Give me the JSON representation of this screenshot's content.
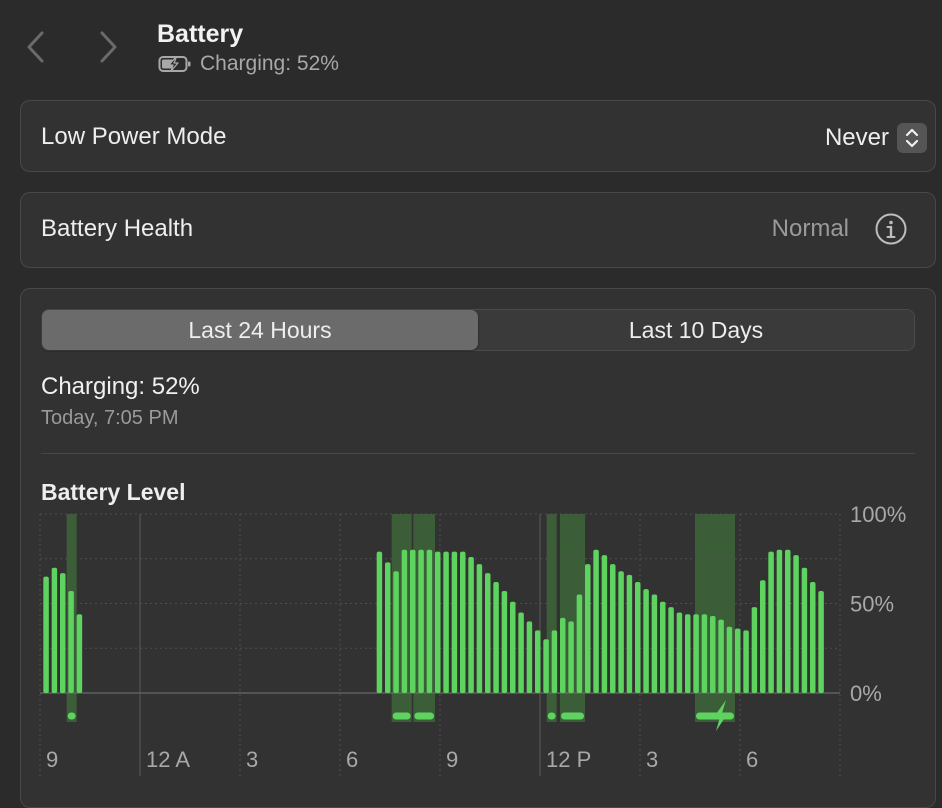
{
  "header": {
    "title": "Battery",
    "subtitle": "Charging: 52%",
    "back_icon": "chevron-left-icon",
    "forward_icon": "chevron-right-icon",
    "battery_icon": "battery-charging-icon"
  },
  "low_power_mode": {
    "label": "Low Power Mode",
    "value": "Never",
    "icon": "up-down-chevron-icon"
  },
  "battery_health": {
    "label": "Battery Health",
    "value": "Normal",
    "icon": "info-circle-icon"
  },
  "usage": {
    "tabs": [
      {
        "label": "Last 24 Hours",
        "selected": true
      },
      {
        "label": "Last 10 Days",
        "selected": false
      }
    ],
    "status": "Charging: 52%",
    "timestamp": "Today, 7:05 PM",
    "chart_title": "Battery Level"
  },
  "colors": {
    "accent_green": "#5fd35f",
    "charging_band": "#3f6e3c",
    "background": "#2b2b2b"
  },
  "chart_data": {
    "type": "bar",
    "title": "Battery Level",
    "x_tick_labels": [
      "9",
      "12 A",
      "3",
      "6",
      "9",
      "12 P",
      "3",
      "6"
    ],
    "y_tick_labels": [
      "100%",
      "50%",
      "0%"
    ],
    "ylim": [
      0,
      100
    ],
    "x_unit": "hours since 9 PM",
    "xlim": [
      0,
      24
    ],
    "bars": [
      {
        "x": 0.25,
        "y": 65
      },
      {
        "x": 0.5,
        "y": 70
      },
      {
        "x": 0.75,
        "y": 67
      },
      {
        "x": 1.0,
        "y": 57
      },
      {
        "x": 1.25,
        "y": 44
      },
      {
        "x": 10.25,
        "y": 79
      },
      {
        "x": 10.5,
        "y": 73
      },
      {
        "x": 10.75,
        "y": 68
      },
      {
        "x": 11.0,
        "y": 80
      },
      {
        "x": 11.25,
        "y": 80
      },
      {
        "x": 11.5,
        "y": 80
      },
      {
        "x": 11.75,
        "y": 80
      },
      {
        "x": 12.0,
        "y": 79
      },
      {
        "x": 12.25,
        "y": 79
      },
      {
        "x": 12.5,
        "y": 79
      },
      {
        "x": 12.75,
        "y": 79
      },
      {
        "x": 13.0,
        "y": 76
      },
      {
        "x": 13.25,
        "y": 72
      },
      {
        "x": 13.5,
        "y": 67
      },
      {
        "x": 13.75,
        "y": 62
      },
      {
        "x": 14.0,
        "y": 57
      },
      {
        "x": 14.25,
        "y": 51
      },
      {
        "x": 14.5,
        "y": 45
      },
      {
        "x": 14.75,
        "y": 40
      },
      {
        "x": 15.0,
        "y": 35
      },
      {
        "x": 15.25,
        "y": 30
      },
      {
        "x": 15.5,
        "y": 35
      },
      {
        "x": 15.75,
        "y": 42
      },
      {
        "x": 16.0,
        "y": 40
      },
      {
        "x": 16.25,
        "y": 55
      },
      {
        "x": 16.5,
        "y": 72
      },
      {
        "x": 16.75,
        "y": 80
      },
      {
        "x": 17.0,
        "y": 77
      },
      {
        "x": 17.25,
        "y": 72
      },
      {
        "x": 17.5,
        "y": 68
      },
      {
        "x": 17.75,
        "y": 66
      },
      {
        "x": 18.0,
        "y": 62
      },
      {
        "x": 18.25,
        "y": 58
      },
      {
        "x": 18.5,
        "y": 55
      },
      {
        "x": 18.75,
        "y": 51
      },
      {
        "x": 19.0,
        "y": 48
      },
      {
        "x": 19.25,
        "y": 45
      },
      {
        "x": 19.5,
        "y": 44
      },
      {
        "x": 19.75,
        "y": 44
      },
      {
        "x": 20.0,
        "y": 44
      },
      {
        "x": 20.25,
        "y": 43
      },
      {
        "x": 20.5,
        "y": 41
      },
      {
        "x": 20.75,
        "y": 37
      },
      {
        "x": 21.0,
        "y": 36
      },
      {
        "x": 21.25,
        "y": 35
      },
      {
        "x": 21.5,
        "y": 48
      },
      {
        "x": 21.75,
        "y": 63
      },
      {
        "x": 22.0,
        "y": 79
      },
      {
        "x": 22.25,
        "y": 80
      },
      {
        "x": 22.5,
        "y": 80
      },
      {
        "x": 22.75,
        "y": 77
      },
      {
        "x": 23.0,
        "y": 70
      },
      {
        "x": 23.25,
        "y": 62
      },
      {
        "x": 23.5,
        "y": 57
      }
    ],
    "charging_intervals": [
      [
        0.8,
        1.1
      ],
      [
        10.55,
        11.15
      ],
      [
        11.2,
        11.85
      ],
      [
        15.2,
        15.5
      ],
      [
        15.6,
        16.35
      ],
      [
        19.65,
        20.85
      ]
    ],
    "charging_now_marker_x": 20.4
  }
}
